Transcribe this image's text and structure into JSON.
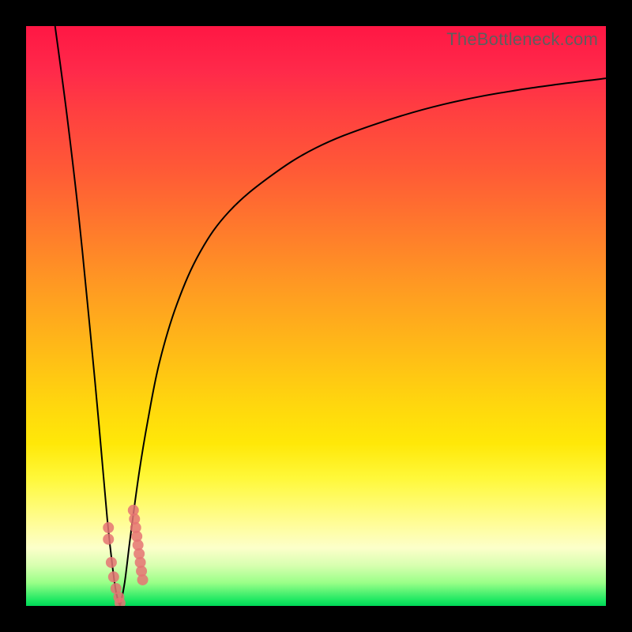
{
  "watermark": "TheBottleneck.com",
  "chart_data": {
    "type": "line",
    "title": "",
    "xlabel": "",
    "ylabel": "",
    "xlim": [
      0,
      100
    ],
    "ylim": [
      0,
      100
    ],
    "grid": false,
    "legend": false,
    "background_gradient": {
      "top": "#ff1744",
      "middle": "#ffd60e",
      "bottom": "#00d858"
    },
    "series": [
      {
        "name": "bottleneck-curve-left",
        "color": "#000000",
        "x": [
          5,
          7,
          9,
          11,
          12.5,
          14,
          15,
          15.6,
          16.2
        ],
        "values": [
          100,
          85,
          68,
          48,
          32,
          15,
          6,
          2,
          0
        ]
      },
      {
        "name": "bottleneck-curve-right",
        "color": "#000000",
        "x": [
          16.2,
          17,
          18,
          19.5,
          21,
          23,
          26,
          30,
          35,
          42,
          50,
          60,
          72,
          85,
          100
        ],
        "values": [
          0,
          4,
          12,
          23,
          32,
          42,
          52,
          61,
          68,
          74,
          79,
          83,
          86.5,
          89,
          91
        ]
      }
    ],
    "markers": [
      {
        "name": "data-points-left-branch",
        "color": "#e57373",
        "shape": "circle",
        "x": [
          14.2,
          14.2,
          14.7,
          15.1,
          15.5,
          16.0,
          16.2
        ],
        "values": [
          13.5,
          11.5,
          7.5,
          5.0,
          3.0,
          1.5,
          0.5
        ]
      },
      {
        "name": "data-points-right-branch",
        "color": "#e57373",
        "shape": "circle",
        "x": [
          18.5,
          18.7,
          18.9,
          19.1,
          19.3,
          19.5,
          19.7,
          19.9,
          20.1
        ],
        "values": [
          16.5,
          15.0,
          13.5,
          12.0,
          10.5,
          9.0,
          7.5,
          6.0,
          4.5
        ]
      }
    ]
  }
}
